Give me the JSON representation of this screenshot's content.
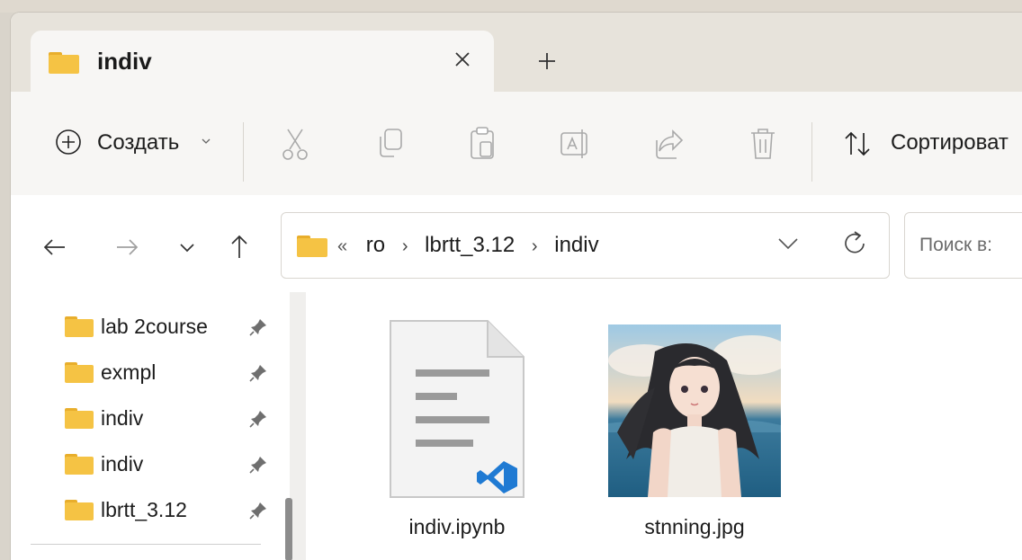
{
  "tab": {
    "title": "indiv",
    "close_icon": "close-icon",
    "new_tab_icon": "plus-icon"
  },
  "toolbar": {
    "create_label": "Создать",
    "sort_label": "Сортироват",
    "icons": [
      "cut-icon",
      "copy-icon",
      "paste-icon",
      "rename-icon",
      "share-icon",
      "delete-icon"
    ]
  },
  "address": {
    "overflow": "«",
    "crumbs": [
      "ro",
      "lbrtt_3.12",
      "indiv"
    ],
    "separator": "›"
  },
  "search": {
    "placeholder": "Поиск в:"
  },
  "sidebar": {
    "items": [
      {
        "label": "lab 2course"
      },
      {
        "label": "exmpl"
      },
      {
        "label": "indiv"
      },
      {
        "label": "indiv"
      },
      {
        "label": "lbrtt_3.12"
      }
    ]
  },
  "files": [
    {
      "name": "indiv.ipynb",
      "icon": "notebook-file-icon"
    },
    {
      "name": "stnning.jpg",
      "icon": "image-thumbnail"
    }
  ],
  "colors": {
    "folder": "#f5c344",
    "accent": "#0a6ac9",
    "vscode": "#1f7ad3"
  }
}
